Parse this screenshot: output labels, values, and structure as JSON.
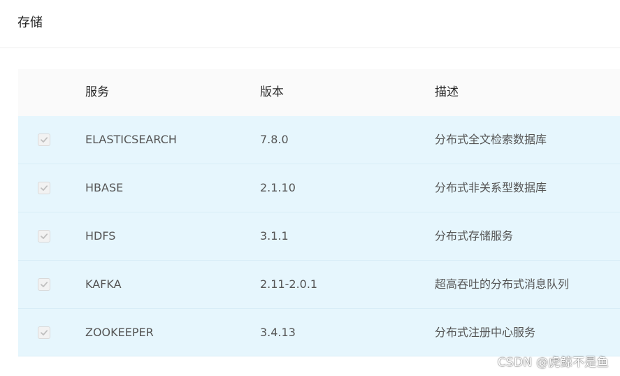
{
  "section": {
    "title": "存储"
  },
  "table": {
    "headers": {
      "service": "服务",
      "version": "版本",
      "description": "描述"
    },
    "rows": [
      {
        "checked": true,
        "service": "ELASTICSEARCH",
        "version": "7.8.0",
        "description": "分布式全文检索数据库"
      },
      {
        "checked": true,
        "service": "HBASE",
        "version": "2.1.10",
        "description": "分布式非关系型数据库"
      },
      {
        "checked": true,
        "service": "HDFS",
        "version": "3.1.1",
        "description": "分布式存储服务"
      },
      {
        "checked": true,
        "service": "KAFKA",
        "version": "2.11-2.0.1",
        "description": "超高吞吐的分布式消息队列"
      },
      {
        "checked": true,
        "service": "ZOOKEEPER",
        "version": "3.4.13",
        "description": "分布式注册中心服务"
      }
    ]
  },
  "watermark": "CSDN @虎鲸不是鱼",
  "colors": {
    "row_background": "#e6f6fd",
    "header_background": "#fafafa",
    "checkbox_check": "#bfbfbf"
  },
  "icons": {
    "checkbox": "check-icon"
  }
}
